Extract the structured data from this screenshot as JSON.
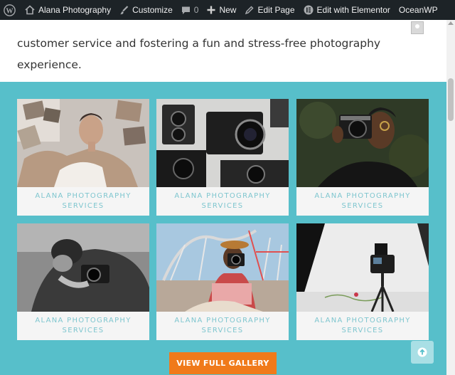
{
  "admin_bar": {
    "site_name": "Alana Photography",
    "customize": "Customize",
    "comments_count": "0",
    "new": "New",
    "edit_page": "Edit Page",
    "edit_elementor": "Edit with Elementor",
    "theme": "OceanWP"
  },
  "intro": {
    "text": "customer service and fostering a fun and stress-free photography experience."
  },
  "gallery": {
    "cards": [
      {
        "line1": "ALANA PHOTOGRAPHY",
        "line2": "SERVICES"
      },
      {
        "line1": "ALANA PHOTOGRAPHY",
        "line2": "SERVICES"
      },
      {
        "line1": "ALANA PHOTOGRAPHY",
        "line2": "SERVICES"
      },
      {
        "line1": "ALANA PHOTOGRAPHY",
        "line2": "SERVICES"
      },
      {
        "line1": "ALANA PHOTOGRAPHY",
        "line2": "SERVICES"
      },
      {
        "line1": "ALANA PHOTOGRAPHY",
        "line2": "SERVICES"
      }
    ],
    "button_label": "VIEW FULL GALLERY"
  },
  "colors": {
    "admin_bar_bg": "#1d2327",
    "section_bg": "#57bfca",
    "caption_text": "#7fc6cf",
    "button_bg": "#f07a1a",
    "scroll_top_bg": "#a9dfe5"
  },
  "icons": {
    "wp_logo": "wordpress-icon",
    "customize": "paintbrush-icon",
    "comments": "comment-bubble-icon",
    "new": "plus-icon",
    "edit": "pencil-icon",
    "elementor": "elementor-icon",
    "scroll_top": "arrow-up-circle-icon"
  }
}
